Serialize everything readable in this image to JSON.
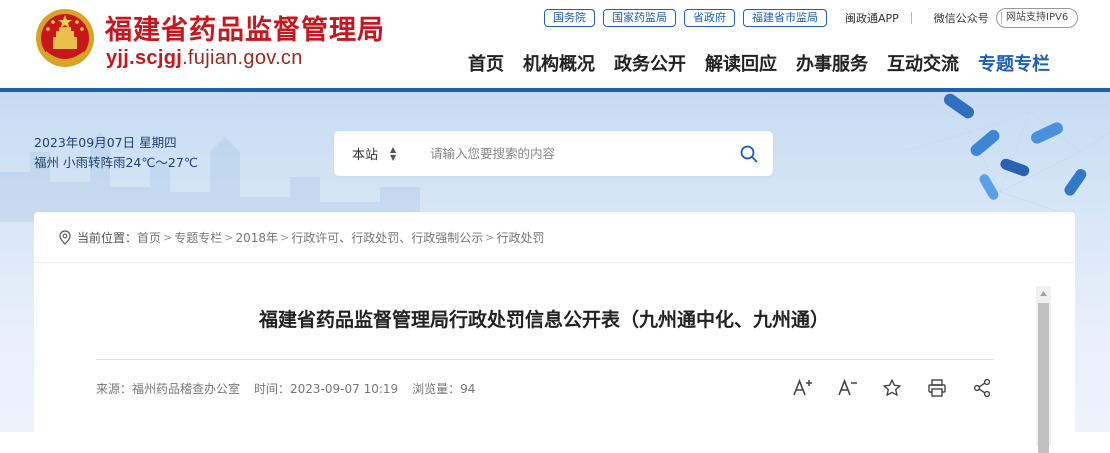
{
  "header": {
    "site_name": "福建省药品监督管理局",
    "domain_prefix": "yjj.scjgj",
    "domain_suffix": ".fujian.gov.cn",
    "top_links": [
      "国务院",
      "国家药监局",
      "省政府",
      "福建省市监局"
    ],
    "app_label": "闽政通APP",
    "wechat_label": "微信公众号",
    "ipv6_label": "网站支持IPV6",
    "nav": [
      "首页",
      "机构概况",
      "政务公开",
      "解读回应",
      "办事服务",
      "互动交流",
      "专题专栏"
    ],
    "active_nav": "专题专栏"
  },
  "weather": {
    "date_line": "2023年09月07日 星期四",
    "weather_line": "福州 小雨转阵雨24℃～27℃"
  },
  "search": {
    "scope": "本站",
    "placeholder": "请输入您要搜索的内容"
  },
  "breadcrumb": {
    "label": "当前位置：",
    "items": [
      "首页",
      "专题专栏",
      "2018年",
      "行政许可、行政处罚、行政强制公示",
      "行政处罚"
    ]
  },
  "article": {
    "title": "福建省药品监督管理局行政处罚信息公开表（九州通中化、九州通）",
    "source": "来源：福州药品稽查办公室",
    "time": "时间：2023-09-07 10:19",
    "views": "浏览量：94"
  },
  "colors": {
    "brand_red": "#c8161d",
    "brand_blue": "#1e5fb4"
  }
}
